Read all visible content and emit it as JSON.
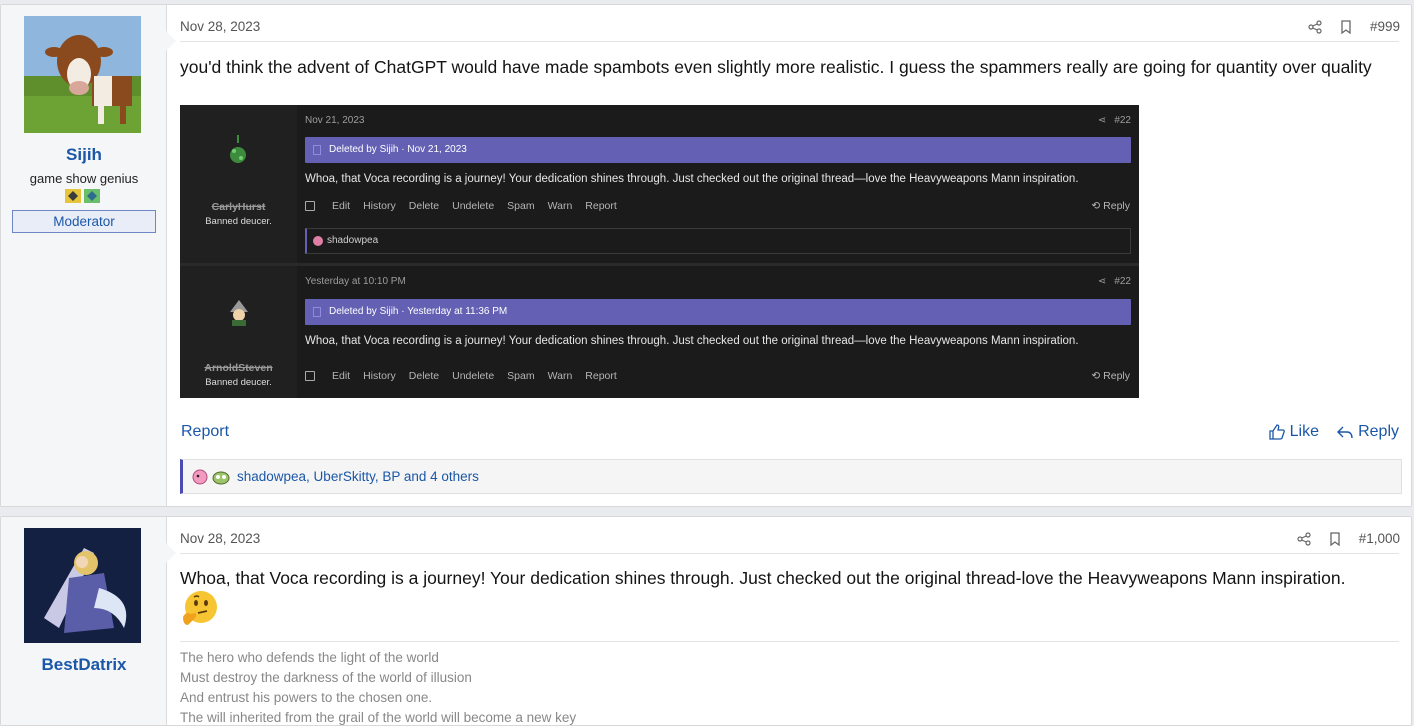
{
  "post1": {
    "username": "Sijih",
    "user_title": "game show genius",
    "role_badge": "Moderator",
    "date": "Nov 28, 2023",
    "post_number": "#999",
    "body": "you'd think the advent of ChatGPT would have made spambots even slightly more realistic. I guess the spammers really are going for quantity over quality",
    "report_label": "Report",
    "like_label": "Like",
    "reply_label": "Reply",
    "reactions_text": "shadowpea, UberSkitty, BP and 4 others",
    "screenshot": {
      "entry1": {
        "username": "CarlyHurst",
        "user_title": "Banned deucer.",
        "date": "Nov 21, 2023",
        "num": "#22",
        "deleted_text": "Deleted by Sijih · Nov 21, 2023",
        "message": "Whoa, that Voca recording is a journey! Your dedication shines through. Just checked out the original thread—love the Heavyweapons Mann inspiration.",
        "reaction_user": "shadowpea"
      },
      "entry2": {
        "username": "ArnoldSteven",
        "user_title": "Banned deucer.",
        "date": "Yesterday at 10:10 PM",
        "num": "#22",
        "deleted_text": "Deleted by Sijih · Yesterday at 11:36 PM",
        "message": "Whoa, that Voca recording is a journey! Your dedication shines through. Just checked out the original thread—love the Heavyweapons Mann inspiration."
      },
      "actions": [
        "Edit",
        "History",
        "Delete",
        "Undelete",
        "Spam",
        "Warn",
        "Report"
      ],
      "reply_label": "Reply"
    }
  },
  "post2": {
    "username": "BestDatrix",
    "date": "Nov 28, 2023",
    "post_number": "#1,000",
    "body": "Whoa, that Voca recording is a journey! Your dedication shines through. Just checked out the original thread-love the Heavyweapons Mann inspiration.",
    "emoji": "thinking-face",
    "signature": [
      "The hero who defends the light of the world",
      "Must destroy the darkness of the world of illusion",
      "And entrust his powers to the chosen one.",
      "The will inherited from the grail of the world will become a new key"
    ]
  },
  "colors": {
    "link": "#1b57a8",
    "deleted_banner": "#6461b4"
  }
}
